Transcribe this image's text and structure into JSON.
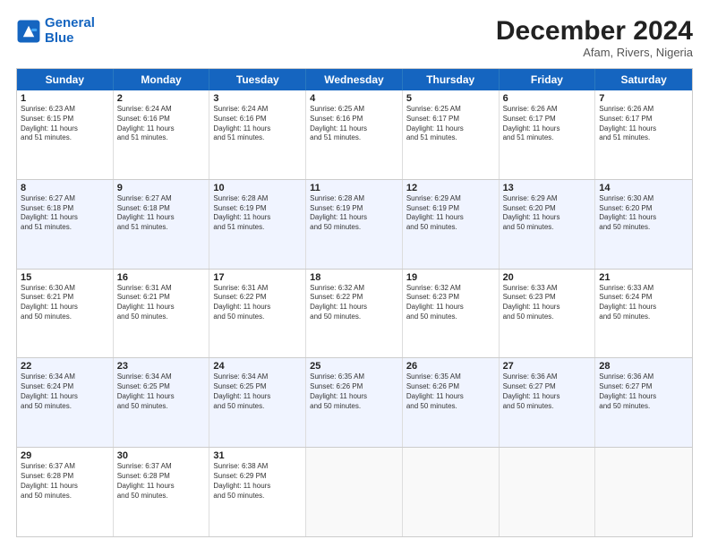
{
  "logo": {
    "line1": "General",
    "line2": "Blue"
  },
  "title": "December 2024",
  "subtitle": "Afam, Rivers, Nigeria",
  "days": [
    "Sunday",
    "Monday",
    "Tuesday",
    "Wednesday",
    "Thursday",
    "Friday",
    "Saturday"
  ],
  "weeks": [
    [
      {
        "day": "1",
        "info": "Sunrise: 6:23 AM\nSunset: 6:15 PM\nDaylight: 11 hours\nand 51 minutes."
      },
      {
        "day": "2",
        "info": "Sunrise: 6:24 AM\nSunset: 6:16 PM\nDaylight: 11 hours\nand 51 minutes."
      },
      {
        "day": "3",
        "info": "Sunrise: 6:24 AM\nSunset: 6:16 PM\nDaylight: 11 hours\nand 51 minutes."
      },
      {
        "day": "4",
        "info": "Sunrise: 6:25 AM\nSunset: 6:16 PM\nDaylight: 11 hours\nand 51 minutes."
      },
      {
        "day": "5",
        "info": "Sunrise: 6:25 AM\nSunset: 6:17 PM\nDaylight: 11 hours\nand 51 minutes."
      },
      {
        "day": "6",
        "info": "Sunrise: 6:26 AM\nSunset: 6:17 PM\nDaylight: 11 hours\nand 51 minutes."
      },
      {
        "day": "7",
        "info": "Sunrise: 6:26 AM\nSunset: 6:17 PM\nDaylight: 11 hours\nand 51 minutes."
      }
    ],
    [
      {
        "day": "8",
        "info": "Sunrise: 6:27 AM\nSunset: 6:18 PM\nDaylight: 11 hours\nand 51 minutes."
      },
      {
        "day": "9",
        "info": "Sunrise: 6:27 AM\nSunset: 6:18 PM\nDaylight: 11 hours\nand 51 minutes."
      },
      {
        "day": "10",
        "info": "Sunrise: 6:28 AM\nSunset: 6:19 PM\nDaylight: 11 hours\nand 51 minutes."
      },
      {
        "day": "11",
        "info": "Sunrise: 6:28 AM\nSunset: 6:19 PM\nDaylight: 11 hours\nand 50 minutes."
      },
      {
        "day": "12",
        "info": "Sunrise: 6:29 AM\nSunset: 6:19 PM\nDaylight: 11 hours\nand 50 minutes."
      },
      {
        "day": "13",
        "info": "Sunrise: 6:29 AM\nSunset: 6:20 PM\nDaylight: 11 hours\nand 50 minutes."
      },
      {
        "day": "14",
        "info": "Sunrise: 6:30 AM\nSunset: 6:20 PM\nDaylight: 11 hours\nand 50 minutes."
      }
    ],
    [
      {
        "day": "15",
        "info": "Sunrise: 6:30 AM\nSunset: 6:21 PM\nDaylight: 11 hours\nand 50 minutes."
      },
      {
        "day": "16",
        "info": "Sunrise: 6:31 AM\nSunset: 6:21 PM\nDaylight: 11 hours\nand 50 minutes."
      },
      {
        "day": "17",
        "info": "Sunrise: 6:31 AM\nSunset: 6:22 PM\nDaylight: 11 hours\nand 50 minutes."
      },
      {
        "day": "18",
        "info": "Sunrise: 6:32 AM\nSunset: 6:22 PM\nDaylight: 11 hours\nand 50 minutes."
      },
      {
        "day": "19",
        "info": "Sunrise: 6:32 AM\nSunset: 6:23 PM\nDaylight: 11 hours\nand 50 minutes."
      },
      {
        "day": "20",
        "info": "Sunrise: 6:33 AM\nSunset: 6:23 PM\nDaylight: 11 hours\nand 50 minutes."
      },
      {
        "day": "21",
        "info": "Sunrise: 6:33 AM\nSunset: 6:24 PM\nDaylight: 11 hours\nand 50 minutes."
      }
    ],
    [
      {
        "day": "22",
        "info": "Sunrise: 6:34 AM\nSunset: 6:24 PM\nDaylight: 11 hours\nand 50 minutes."
      },
      {
        "day": "23",
        "info": "Sunrise: 6:34 AM\nSunset: 6:25 PM\nDaylight: 11 hours\nand 50 minutes."
      },
      {
        "day": "24",
        "info": "Sunrise: 6:34 AM\nSunset: 6:25 PM\nDaylight: 11 hours\nand 50 minutes."
      },
      {
        "day": "25",
        "info": "Sunrise: 6:35 AM\nSunset: 6:26 PM\nDaylight: 11 hours\nand 50 minutes."
      },
      {
        "day": "26",
        "info": "Sunrise: 6:35 AM\nSunset: 6:26 PM\nDaylight: 11 hours\nand 50 minutes."
      },
      {
        "day": "27",
        "info": "Sunrise: 6:36 AM\nSunset: 6:27 PM\nDaylight: 11 hours\nand 50 minutes."
      },
      {
        "day": "28",
        "info": "Sunrise: 6:36 AM\nSunset: 6:27 PM\nDaylight: 11 hours\nand 50 minutes."
      }
    ],
    [
      {
        "day": "29",
        "info": "Sunrise: 6:37 AM\nSunset: 6:28 PM\nDaylight: 11 hours\nand 50 minutes."
      },
      {
        "day": "30",
        "info": "Sunrise: 6:37 AM\nSunset: 6:28 PM\nDaylight: 11 hours\nand 50 minutes."
      },
      {
        "day": "31",
        "info": "Sunrise: 6:38 AM\nSunset: 6:29 PM\nDaylight: 11 hours\nand 50 minutes."
      },
      {
        "day": "",
        "info": ""
      },
      {
        "day": "",
        "info": ""
      },
      {
        "day": "",
        "info": ""
      },
      {
        "day": "",
        "info": ""
      }
    ]
  ]
}
